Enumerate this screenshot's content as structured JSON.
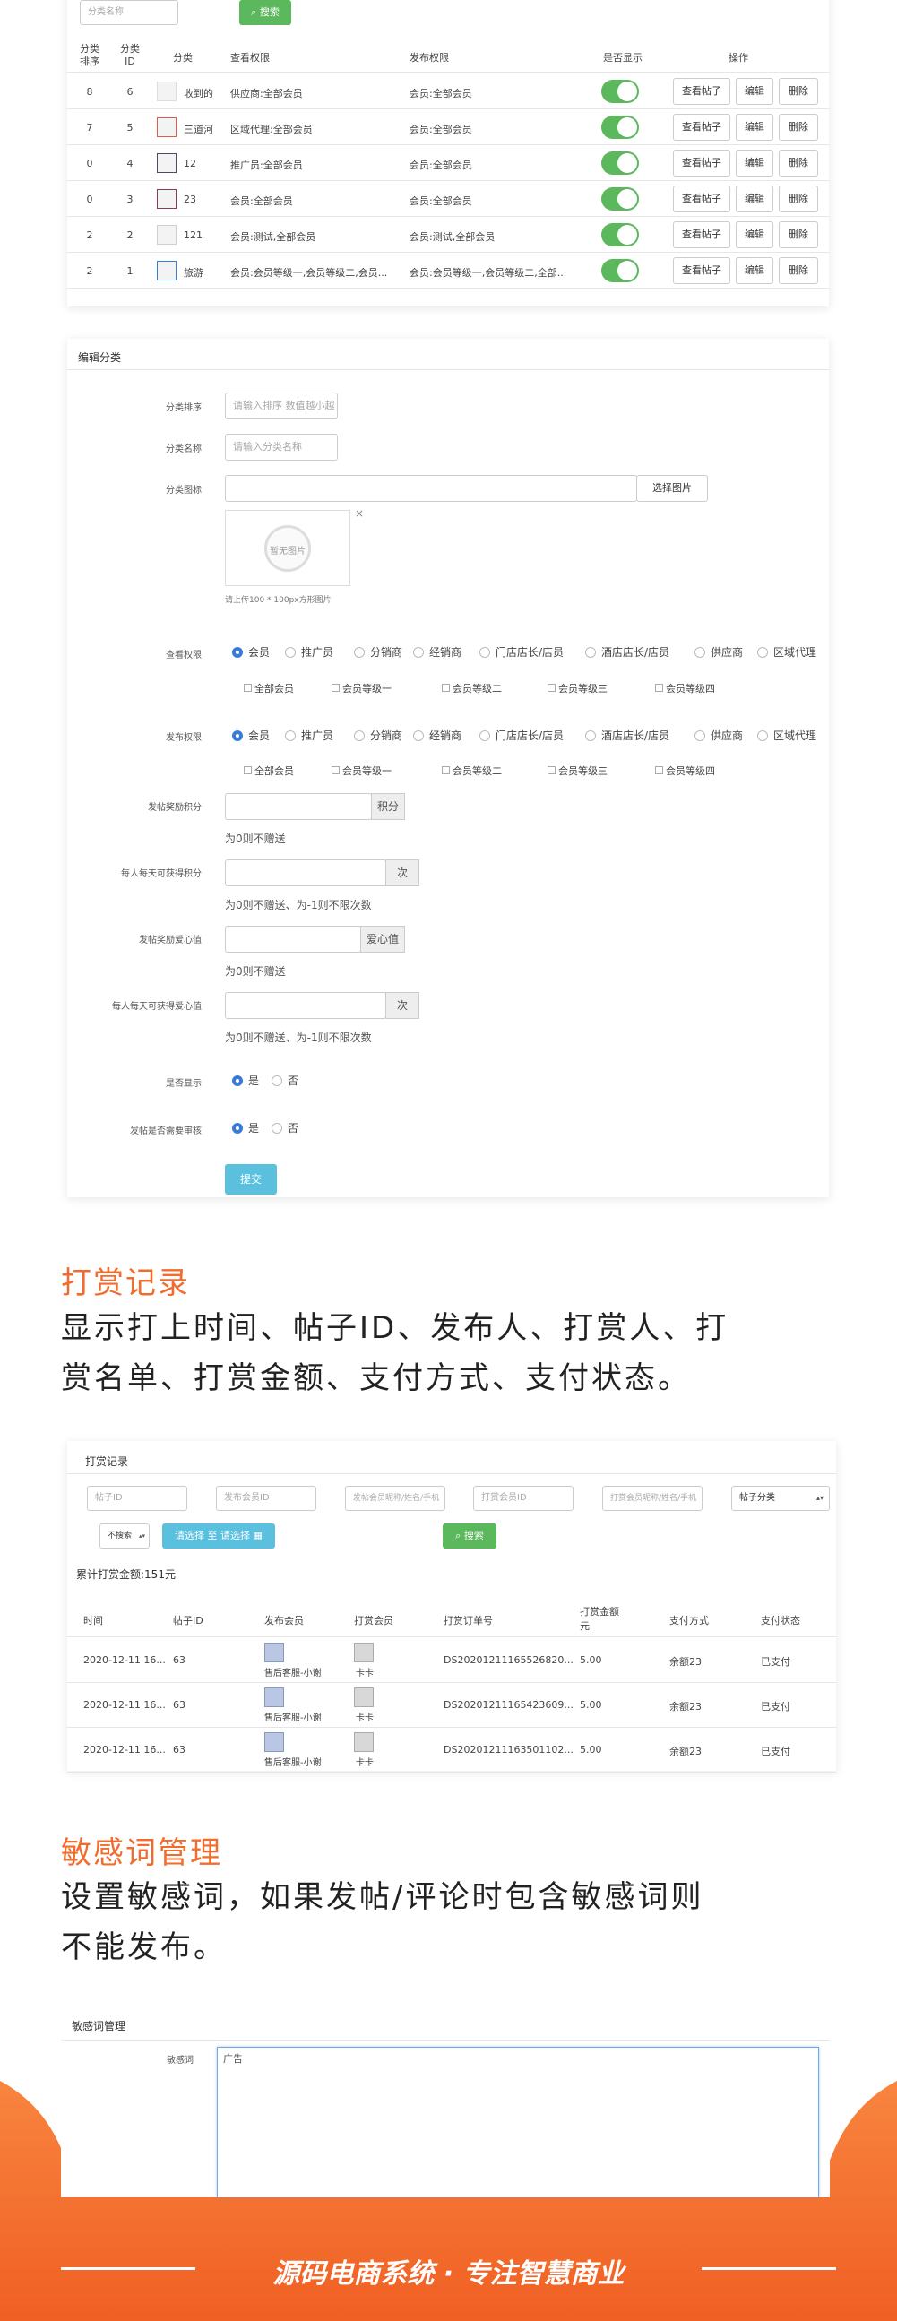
{
  "category_list": {
    "search_placeholder": "分类名称",
    "search_button": "搜索",
    "headers": [
      "分类\n排序",
      "分类\nID",
      "分类",
      "查看权限",
      "发布权限",
      "是否显示",
      "操作"
    ],
    "rows": [
      {
        "sort": "8",
        "id": "6",
        "name": "收到的",
        "view": "供应商:全部会员",
        "publish": "会员:全部会员"
      },
      {
        "sort": "7",
        "id": "5",
        "name": "三道河",
        "view": "区域代理:全部会员",
        "publish": "会员:全部会员"
      },
      {
        "sort": "0",
        "id": "4",
        "name": "12",
        "view": "推广员:全部会员",
        "publish": "会员:全部会员"
      },
      {
        "sort": "0",
        "id": "3",
        "name": "23",
        "view": "会员:全部会员",
        "publish": "会员:全部会员"
      },
      {
        "sort": "2",
        "id": "2",
        "name": "121",
        "view": "会员:测试,全部会员",
        "publish": "会员:测试,全部会员"
      },
      {
        "sort": "2",
        "id": "1",
        "name": "旅游",
        "view": "会员:会员等级一,会员等级二,会员...",
        "publish": "会员:会员等级一,会员等级二,全部..."
      }
    ],
    "actions": {
      "view_posts": "查看帖子",
      "edit": "编辑",
      "delete": "删除"
    }
  },
  "edit_category": {
    "title": "编辑分类",
    "sort_label": "分类排序",
    "sort_placeholder": "请输入排序 数值越小越",
    "name_label": "分类名称",
    "name_placeholder": "请输入分类名称",
    "icon_label": "分类图标",
    "choose_image": "选择图片",
    "no_image": "暂无图片",
    "close": "×",
    "upload_hint": "请上传100 * 100px方形图片",
    "view_perm_label": "查看权限",
    "publish_perm_label": "发布权限",
    "roles": [
      "会员",
      "推广员",
      "分销商",
      "经销商",
      "门店店长/店员",
      "酒店店长/店员",
      "供应商",
      "区域代理"
    ],
    "levels": [
      "全部会员",
      "会员等级一",
      "会员等级二",
      "会员等级三",
      "会员等级四"
    ],
    "reward_points_label": "发帖奖励积分",
    "reward_points_addon": "积分",
    "reward_points_help": "为0则不赠送",
    "daily_points_label": "每人每天可获得积分",
    "daily_points_addon": "次",
    "daily_points_help": "为0则不赠送、为-1则不限次数",
    "reward_love_label": "发帖奖励爱心值",
    "reward_love_addon": "爱心值",
    "reward_love_help": "为0则不赠送",
    "daily_love_label": "每人每天可获得爱心值",
    "daily_love_addon": "次",
    "daily_love_help": "为0则不赠送、为-1则不限次数",
    "show_label": "是否显示",
    "audit_label": "发帖是否需要审核",
    "yes": "是",
    "no": "否",
    "submit": "提交"
  },
  "tip_section": {
    "title": "打赏记录",
    "desc_line1": "显示打上时间、帖子ID、发布人、打赏人、打",
    "desc_line2": "赏名单、打赏金额、支付方式、支付状态。"
  },
  "tip_records": {
    "title": "打赏记录",
    "filters": {
      "post_id": "帖子ID",
      "publisher_id": "发布会员ID",
      "publisher_info": "发帖会员昵称/姓名/手机",
      "tipper_id": "打赏会员ID",
      "tipper_info": "打赏会员昵称/姓名/手机",
      "category": "帖子分类",
      "search_type": "不搜索",
      "date_range": "请选择 至 请选择",
      "search_button": "搜索"
    },
    "total": "累计打赏金额:151元",
    "headers": [
      "时间",
      "帖子ID",
      "发布会员",
      "打赏会员",
      "打赏订单号",
      "打赏金额\n元",
      "支付方式",
      "支付状态"
    ],
    "rows": [
      {
        "time": "2020-12-11 16...",
        "post_id": "63",
        "publisher": "售后客服-小谢",
        "tipper": "卡卡",
        "order": "DS20201211165526820...",
        "amount": "5.00",
        "pay": "余额23",
        "status": "已支付"
      },
      {
        "time": "2020-12-11 16...",
        "post_id": "63",
        "publisher": "售后客服-小谢",
        "tipper": "卡卡",
        "order": "DS20201211165423609...",
        "amount": "5.00",
        "pay": "余额23",
        "status": "已支付"
      },
      {
        "time": "2020-12-11 16...",
        "post_id": "63",
        "publisher": "售后客服-小谢",
        "tipper": "卡卡",
        "order": "DS20201211163501102...",
        "amount": "5.00",
        "pay": "余额23",
        "status": "已支付"
      }
    ]
  },
  "sensitive_section": {
    "title": "敏感词管理",
    "desc_line1": "设置敏感词，如果发帖/评论时包含敏感词则",
    "desc_line2": "不能发布。"
  },
  "sensitive_panel": {
    "title": "敏感词管理",
    "label": "敏感词",
    "value": "广告"
  },
  "footer": {
    "slogan": "源码电商系统 · 专注智慧商业"
  },
  "colors": {
    "accent": "#f26c2d",
    "green": "#5cb85c",
    "blue": "#5bc0de"
  }
}
